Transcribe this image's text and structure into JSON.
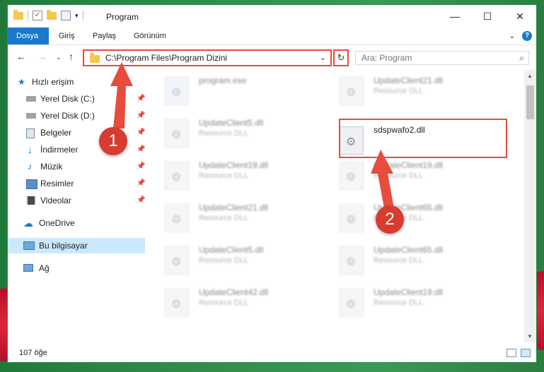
{
  "window": {
    "title": "Program",
    "minimize_glyph": "—",
    "maximize_glyph": "☐",
    "close_glyph": "✕"
  },
  "ribbon": {
    "tabs": [
      "Dosya",
      "Giriş",
      "Paylaş",
      "Görünüm"
    ]
  },
  "address": {
    "path": "C:\\Program Files\\Program Dizini"
  },
  "search": {
    "placeholder": "Ara: Program"
  },
  "sidebar": {
    "quick_access": "Hızlı erişim",
    "items": [
      {
        "label": "Yerel Disk (C:)",
        "icon": "drive-icon",
        "pinned": true
      },
      {
        "label": "Yerel Disk (D:)",
        "icon": "drive-icon",
        "pinned": true
      },
      {
        "label": "Belgeler",
        "icon": "documents-icon",
        "pinned": true
      },
      {
        "label": "İndirmeler",
        "icon": "downloads-icon",
        "pinned": true
      },
      {
        "label": "Müzik",
        "icon": "music-icon",
        "pinned": true
      },
      {
        "label": "Resimler",
        "icon": "pictures-icon",
        "pinned": true
      },
      {
        "label": "Videolar",
        "icon": "videos-icon",
        "pinned": true
      }
    ],
    "onedrive": "OneDrive",
    "this_pc": "Bu bilgisayar",
    "network": "Ağ"
  },
  "files": {
    "left_column": [
      {
        "name": "program.exe",
        "type": ""
      },
      {
        "name": "UpdateClient5.dll",
        "type": "Resource DLL"
      },
      {
        "name": "UpdateClient19.dll",
        "type": "Resource DLL"
      },
      {
        "name": "UpdateClient21.dll",
        "type": "Resource DLL"
      },
      {
        "name": "UpdateClient5.dll",
        "type": "Resource DLL"
      },
      {
        "name": "UpdateClient42.dll",
        "type": "Resource DLL"
      }
    ],
    "right_column": [
      {
        "name": "UpdateClient21.dll",
        "type": "Resource DLL"
      },
      {
        "name": "sdspwafo2.dll",
        "type": ""
      },
      {
        "name": "UpdateClient19.dll",
        "type": "Resource DLL"
      },
      {
        "name": "UpdateClient65.dll",
        "type": "Resource DLL"
      },
      {
        "name": "UpdateClient65.dll",
        "type": "Resource DLL"
      },
      {
        "name": "UpdateClient19.dll",
        "type": "Resource DLL"
      }
    ]
  },
  "annotations": {
    "step1": "1",
    "step2": "2",
    "color": "#e74c3c"
  },
  "status": {
    "count": "107 öğe"
  }
}
